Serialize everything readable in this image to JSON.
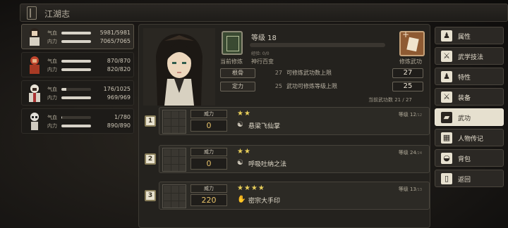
{
  "window": {
    "title": "江湖志"
  },
  "roster": [
    {
      "hp_label": "气血",
      "hp_value": "5981/5981",
      "hp_pct": 1.0,
      "mp_label": "内力",
      "mp_value": "7065/7065",
      "mp_pct": 1.0,
      "active": true
    },
    {
      "hp_label": "气血",
      "hp_value": "870/870",
      "hp_pct": 1.0,
      "mp_label": "内力",
      "mp_value": "820/820",
      "mp_pct": 1.0,
      "active": false
    },
    {
      "hp_label": "气血",
      "hp_value": "176/1025",
      "hp_pct": 0.17,
      "mp_label": "内力",
      "mp_value": "969/969",
      "mp_pct": 1.0,
      "active": false
    },
    {
      "hp_label": "气血",
      "hp_value": "1/780",
      "hp_pct": 0.01,
      "mp_label": "内力",
      "mp_value": "890/890",
      "mp_pct": 1.0,
      "active": false
    }
  ],
  "level": {
    "label": "等级 18",
    "exp_text": "经验: 0/0",
    "left_caption": "当前修炼",
    "mid_caption": "神行百变",
    "train_caption": "修炼武功"
  },
  "stats": [
    {
      "key": "根骨",
      "value": "27",
      "desc": "可修炼武功数上限",
      "box": "27"
    },
    {
      "key": "定力",
      "value": "25",
      "desc": "武功可修炼等级上限",
      "box": "25"
    }
  ],
  "current_count": "当前武功数  21 / 27",
  "skills": [
    {
      "index": "1",
      "power_label": "威力",
      "power": "0",
      "stars": "★★",
      "icon": "☯",
      "name": "悬梁飞仙掌",
      "level": "等级 12",
      "level_sub": "/12"
    },
    {
      "index": "2",
      "power_label": "威力",
      "power": "0",
      "stars": "★★",
      "icon": "☯",
      "name": "呼吸吐纳之法",
      "level": "等级 24",
      "level_sub": "/24"
    },
    {
      "index": "3",
      "power_label": "威力",
      "power": "220",
      "stars": "★★★★",
      "icon": "✋",
      "name": "密宗大手印",
      "level": "等级 13",
      "level_sub": "/13"
    }
  ],
  "menu": [
    {
      "label": "属性",
      "icon": "♟",
      "active": false
    },
    {
      "label": "武学技法",
      "icon": "⚔",
      "active": false
    },
    {
      "label": "特性",
      "icon": "♟",
      "active": false
    },
    {
      "label": "装备",
      "icon": "⚔",
      "active": false
    },
    {
      "label": "武功",
      "icon": "▰",
      "active": true
    },
    {
      "label": "人物传记",
      "icon": "▦",
      "active": false
    },
    {
      "label": "背包",
      "icon": "◒",
      "active": false
    },
    {
      "label": "返回",
      "icon": "▯",
      "active": false
    }
  ],
  "colors": {
    "accent_gold": "#e7c26a",
    "star": "#e9cf5a",
    "panel": "#24221e",
    "menu_active": "#e6e0cf"
  }
}
